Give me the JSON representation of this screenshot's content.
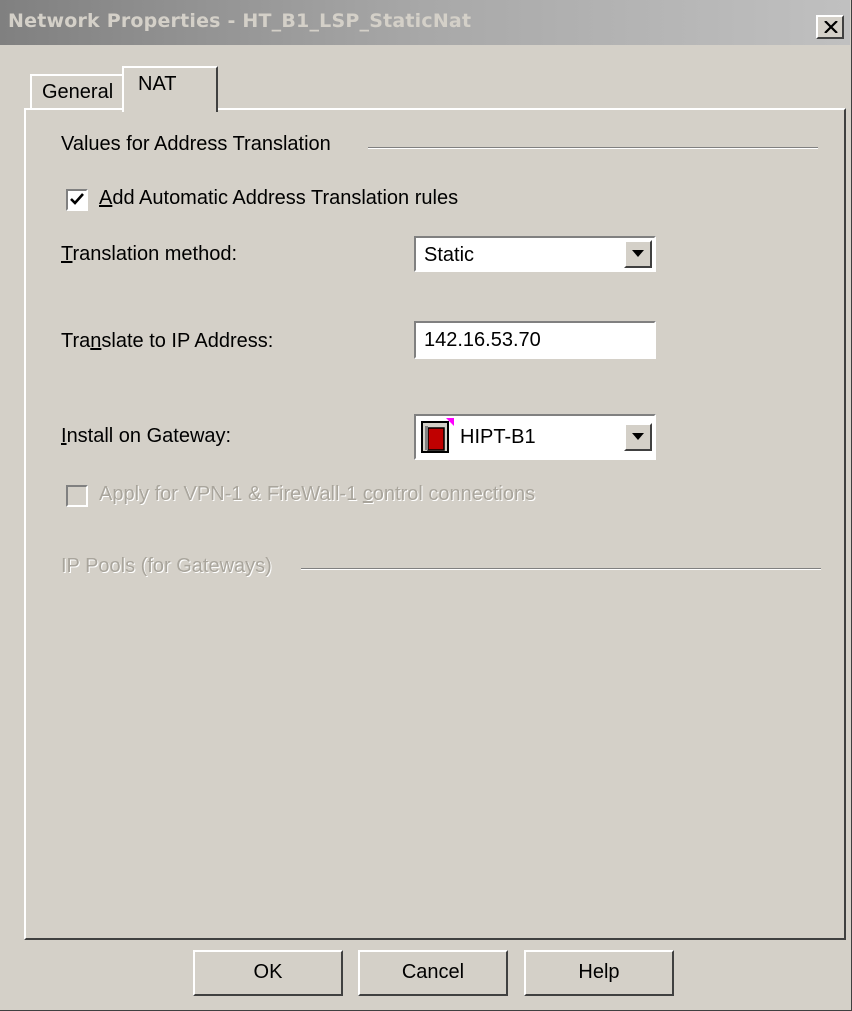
{
  "window": {
    "title": "Network Properties - HT_B1_LSP_StaticNat",
    "close_symbol": "x"
  },
  "tabs": [
    {
      "label": "General",
      "active": false
    },
    {
      "label": "NAT",
      "active": true
    }
  ],
  "nat": {
    "group_title": "Values for Address Translation",
    "add_rules": {
      "label": "Add Automatic Address Translation rules",
      "mnemonic": "A",
      "checked": true
    },
    "translation_method": {
      "label": "Translation method:",
      "mnemonic": "T",
      "value": "Static"
    },
    "translate_ip": {
      "label": "Translate to IP Address:",
      "mnemonic": "n",
      "value": "142.16.53.70"
    },
    "install_gateway": {
      "label": "Install on Gateway:",
      "mnemonic": "I",
      "value": "HIPT-B1",
      "icon": "gateway-icon"
    },
    "apply_vpn": {
      "label": "Apply for VPN-1 & FireWall-1 control connections",
      "mnemonic": "c",
      "checked": false,
      "enabled": false
    },
    "ip_pools_title": "IP Pools (for Gateways)"
  },
  "buttons": {
    "ok": "OK",
    "cancel": "Cancel",
    "help": "Help"
  },
  "colors": {
    "face": "#d4d0c8",
    "shadow": "#808080",
    "dark_shadow": "#404040",
    "highlight": "#ffffff",
    "disabled_text": "#a9a59c",
    "gateway_red": "#c00000",
    "gateway_magenta": "#ff00ff"
  }
}
